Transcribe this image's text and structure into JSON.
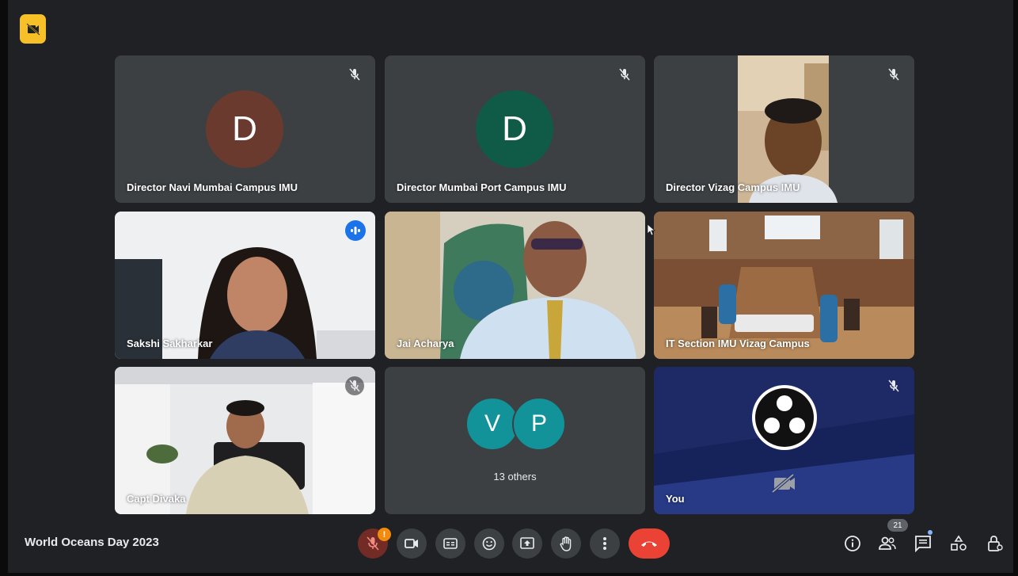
{
  "meeting": {
    "title": "World Oceans Day 2023"
  },
  "tiles": [
    {
      "name": "Director Navi Mumbai Campus IMU",
      "initial": "D",
      "avatar_color": "#6b3a2e",
      "muted": true
    },
    {
      "name": "Director Mumbai Port Campus IMU",
      "initial": "D",
      "avatar_color": "#0f5b48",
      "muted": true
    },
    {
      "name": "Director Vizag Campus IMU",
      "muted": true,
      "video": true
    },
    {
      "name": "Sakshi Sakharkar",
      "speaking": true,
      "video": true
    },
    {
      "name": "Jai Acharya",
      "video": true
    },
    {
      "name": "IT Section IMU Vizag Campus",
      "video": true
    },
    {
      "name": "Capt Divaka",
      "muted": true,
      "video": true
    },
    {
      "others_label": "13 others",
      "others_initials": [
        "V",
        "P"
      ]
    },
    {
      "name": "You",
      "muted": true,
      "camera_off": true
    }
  ],
  "toolbar": {
    "mic_alert": "!",
    "controls": [
      "mic-off-icon",
      "camera-icon",
      "captions-icon",
      "emoji-icon",
      "present-icon",
      "raise-hand-icon",
      "more-options-icon",
      "end-call-icon"
    ]
  },
  "right_controls": {
    "participant_count": "21",
    "icons": [
      "info-icon",
      "people-icon",
      "chat-icon",
      "activities-icon",
      "host-controls-icon"
    ]
  },
  "colors": {
    "background": "#202124",
    "tile": "#3c4043",
    "end_call": "#ea4335",
    "speaking_outline": "#8ab4f8",
    "others_avatar": "#12939a"
  }
}
